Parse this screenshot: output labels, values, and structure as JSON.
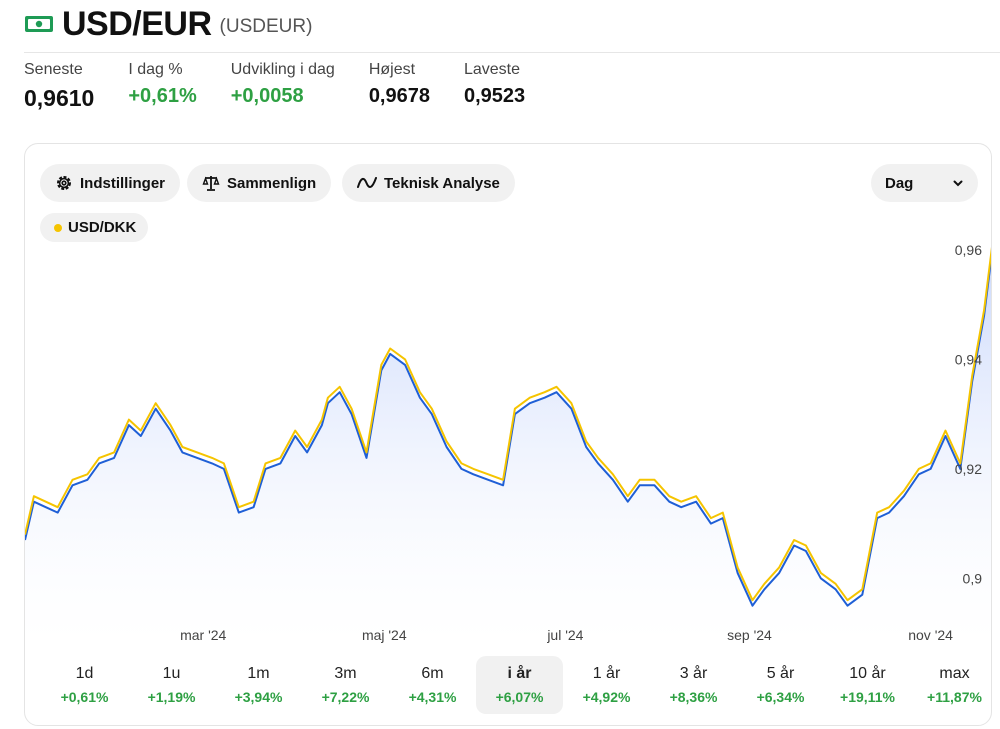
{
  "header": {
    "title": "USD/EUR",
    "ticker": "(USDEUR)",
    "icon": "banknote-icon",
    "icon_color": "#1e9b55"
  },
  "stats": [
    {
      "label": "Seneste",
      "value": "0,9610",
      "positive": false
    },
    {
      "label": "I dag %",
      "value": "+0,61%",
      "positive": true
    },
    {
      "label": "Udvikling i dag",
      "value": "+0,0058",
      "positive": true
    },
    {
      "label": "Højest",
      "value": "0,9678",
      "positive": false
    },
    {
      "label": "Laveste",
      "value": "0,9523",
      "positive": false
    }
  ],
  "toolbar": {
    "settings_label": "Indstillinger",
    "compare_label": "Sammenlign",
    "analysis_label": "Teknisk Analyse",
    "interval_value": "Dag"
  },
  "legend": {
    "label": "USD/DKK",
    "color": "#f5c400"
  },
  "periods": [
    {
      "label": "1d",
      "change": "+0,61%",
      "active": false
    },
    {
      "label": "1u",
      "change": "+1,19%",
      "active": false
    },
    {
      "label": "1m",
      "change": "+3,94%",
      "active": false
    },
    {
      "label": "3m",
      "change": "+7,22%",
      "active": false
    },
    {
      "label": "6m",
      "change": "+4,31%",
      "active": false
    },
    {
      "label": "i år",
      "change": "+6,07%",
      "active": true
    },
    {
      "label": "1 år",
      "change": "+4,92%",
      "active": false
    },
    {
      "label": "3 år",
      "change": "+8,36%",
      "active": false
    },
    {
      "label": "5 år",
      "change": "+6,34%",
      "active": false
    },
    {
      "label": "10 år",
      "change": "+19,11%",
      "active": false
    },
    {
      "label": "max",
      "change": "+11,87%",
      "active": false
    }
  ],
  "chart_data": {
    "type": "line",
    "y_ticks": [
      0.9,
      0.92,
      0.94,
      0.96
    ],
    "y_tick_labels": [
      "0,9",
      "0,92",
      "0,94",
      "0,96"
    ],
    "ylim": [
      0.888,
      0.962
    ],
    "x_tick_labels": [
      "mar '24",
      "maj '24",
      "jul '24",
      "sep '24",
      "nov '24"
    ],
    "x_ticks": [
      "2024-03-01",
      "2024-05-01",
      "2024-07-01",
      "2024-09-01",
      "2024-11-01"
    ],
    "x_range": [
      "2024-01-01",
      "2024-11-22"
    ],
    "colors": {
      "main_line": "#1f5fd6",
      "compare_line": "#f5c400",
      "area_top": "#c9d7fb"
    },
    "series": [
      {
        "name": "USD/EUR",
        "x": [
          "2024-01-01",
          "2024-01-04",
          "2024-01-08",
          "2024-01-12",
          "2024-01-17",
          "2024-01-22",
          "2024-01-26",
          "2024-01-31",
          "2024-02-05",
          "2024-02-09",
          "2024-02-14",
          "2024-02-19",
          "2024-02-23",
          "2024-02-28",
          "2024-03-04",
          "2024-03-08",
          "2024-03-13",
          "2024-03-18",
          "2024-03-22",
          "2024-03-27",
          "2024-04-01",
          "2024-04-05",
          "2024-04-10",
          "2024-04-12",
          "2024-04-16",
          "2024-04-20",
          "2024-04-25",
          "2024-04-30",
          "2024-05-03",
          "2024-05-08",
          "2024-05-13",
          "2024-05-17",
          "2024-05-22",
          "2024-05-27",
          "2024-05-31",
          "2024-06-05",
          "2024-06-10",
          "2024-06-14",
          "2024-06-19",
          "2024-06-24",
          "2024-06-28",
          "2024-07-03",
          "2024-07-08",
          "2024-07-12",
          "2024-07-17",
          "2024-07-22",
          "2024-07-26",
          "2024-07-31",
          "2024-08-05",
          "2024-08-09",
          "2024-08-14",
          "2024-08-19",
          "2024-08-23",
          "2024-08-28",
          "2024-09-02",
          "2024-09-06",
          "2024-09-11",
          "2024-09-16",
          "2024-09-20",
          "2024-09-25",
          "2024-09-30",
          "2024-10-04",
          "2024-10-09",
          "2024-10-14",
          "2024-10-18",
          "2024-10-23",
          "2024-10-28",
          "2024-11-01",
          "2024-11-06",
          "2024-11-11",
          "2024-11-15",
          "2024-11-19",
          "2024-11-22"
        ],
        "values": [
          0.907,
          0.914,
          0.913,
          0.912,
          0.917,
          0.918,
          0.921,
          0.922,
          0.928,
          0.926,
          0.931,
          0.927,
          0.923,
          0.922,
          0.921,
          0.92,
          0.912,
          0.913,
          0.92,
          0.921,
          0.926,
          0.923,
          0.928,
          0.932,
          0.934,
          0.93,
          0.922,
          0.938,
          0.941,
          0.939,
          0.933,
          0.93,
          0.924,
          0.92,
          0.919,
          0.918,
          0.917,
          0.93,
          0.932,
          0.933,
          0.934,
          0.931,
          0.924,
          0.921,
          0.918,
          0.914,
          0.917,
          0.917,
          0.914,
          0.913,
          0.914,
          0.91,
          0.911,
          0.901,
          0.895,
          0.898,
          0.901,
          0.906,
          0.905,
          0.9,
          0.898,
          0.895,
          0.897,
          0.911,
          0.912,
          0.915,
          0.919,
          0.92,
          0.926,
          0.92,
          0.936,
          0.948,
          0.961
        ]
      },
      {
        "name": "USD/DKK",
        "x": [
          "2024-01-01",
          "2024-01-04",
          "2024-01-08",
          "2024-01-12",
          "2024-01-17",
          "2024-01-22",
          "2024-01-26",
          "2024-01-31",
          "2024-02-05",
          "2024-02-09",
          "2024-02-14",
          "2024-02-19",
          "2024-02-23",
          "2024-02-28",
          "2024-03-04",
          "2024-03-08",
          "2024-03-13",
          "2024-03-18",
          "2024-03-22",
          "2024-03-27",
          "2024-04-01",
          "2024-04-05",
          "2024-04-10",
          "2024-04-12",
          "2024-04-16",
          "2024-04-20",
          "2024-04-25",
          "2024-04-30",
          "2024-05-03",
          "2024-05-08",
          "2024-05-13",
          "2024-05-17",
          "2024-05-22",
          "2024-05-27",
          "2024-05-31",
          "2024-06-05",
          "2024-06-10",
          "2024-06-14",
          "2024-06-19",
          "2024-06-24",
          "2024-06-28",
          "2024-07-03",
          "2024-07-08",
          "2024-07-12",
          "2024-07-17",
          "2024-07-22",
          "2024-07-26",
          "2024-07-31",
          "2024-08-05",
          "2024-08-09",
          "2024-08-14",
          "2024-08-19",
          "2024-08-23",
          "2024-08-28",
          "2024-09-02",
          "2024-09-06",
          "2024-09-11",
          "2024-09-16",
          "2024-09-20",
          "2024-09-25",
          "2024-09-30",
          "2024-10-04",
          "2024-10-09",
          "2024-10-14",
          "2024-10-18",
          "2024-10-23",
          "2024-10-28",
          "2024-11-01",
          "2024-11-06",
          "2024-11-11",
          "2024-11-15",
          "2024-11-19",
          "2024-11-22"
        ],
        "values": [
          0.908,
          0.915,
          0.914,
          0.913,
          0.918,
          0.919,
          0.922,
          0.923,
          0.929,
          0.927,
          0.932,
          0.928,
          0.924,
          0.923,
          0.922,
          0.921,
          0.913,
          0.914,
          0.921,
          0.922,
          0.927,
          0.924,
          0.929,
          0.933,
          0.935,
          0.931,
          0.923,
          0.939,
          0.942,
          0.94,
          0.934,
          0.931,
          0.925,
          0.921,
          0.92,
          0.919,
          0.918,
          0.931,
          0.933,
          0.934,
          0.935,
          0.932,
          0.925,
          0.922,
          0.919,
          0.915,
          0.918,
          0.918,
          0.915,
          0.914,
          0.915,
          0.911,
          0.912,
          0.902,
          0.896,
          0.899,
          0.902,
          0.907,
          0.906,
          0.901,
          0.899,
          0.896,
          0.898,
          0.912,
          0.913,
          0.916,
          0.92,
          0.921,
          0.927,
          0.921,
          0.937,
          0.949,
          0.962
        ]
      }
    ]
  }
}
